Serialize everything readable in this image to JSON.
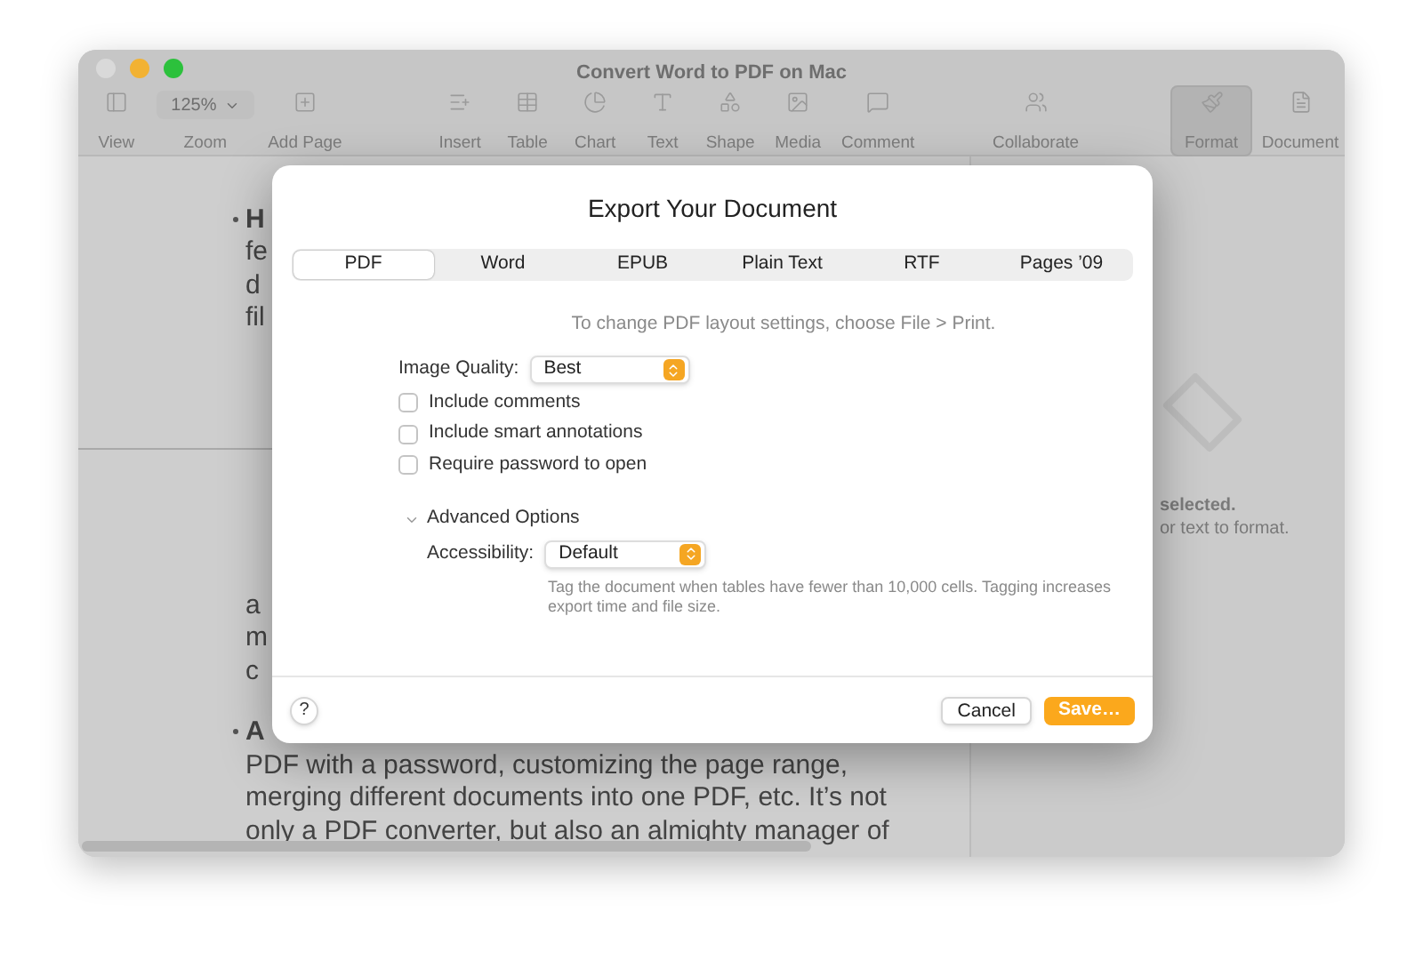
{
  "window": {
    "title": "Convert Word to PDF on Mac"
  },
  "toolbar": [
    {
      "label": "View",
      "selected": false
    },
    {
      "label": "Zoom",
      "value": "125%",
      "selected": false
    },
    {
      "label": "Add Page",
      "selected": false
    },
    {
      "label": "Insert",
      "selected": false
    },
    {
      "label": "Table",
      "selected": false
    },
    {
      "label": "Chart",
      "selected": false
    },
    {
      "label": "Text",
      "selected": false
    },
    {
      "label": "Shape",
      "selected": false
    },
    {
      "label": "Media",
      "selected": false
    },
    {
      "label": "Comment",
      "selected": false
    },
    {
      "label": "Collaborate",
      "selected": false
    },
    {
      "label": "Format",
      "selected": true
    },
    {
      "label": "Document",
      "selected": false
    }
  ],
  "document": {
    "block_1": [
      {
        "text": "H",
        "bullet": true
      },
      {
        "text": "fe",
        "bullet": false
      },
      {
        "text": "d",
        "bullet": false
      },
      {
        "text": "fil",
        "bullet": false
      }
    ],
    "block_2": [
      {
        "text": "a",
        "bullet": false
      },
      {
        "text": "m",
        "bullet": false
      },
      {
        "text": "c",
        "bullet": false
      }
    ],
    "block_3": [
      {
        "text": "A",
        "bullet": true
      },
      {
        "text": "PDF with a password, customizing the page range,",
        "bullet": false
      },
      {
        "text": "merging different documents into one PDF, etc. It’s not",
        "bullet": false
      },
      {
        "text": "only a PDF converter, but also an almighty manager of",
        "bullet": false
      }
    ]
  },
  "inspector": {
    "lines": [
      "selected.",
      "or text to format."
    ]
  },
  "dialog": {
    "title": "Export Your Document",
    "tabs": [
      {
        "label": "PDF",
        "selected": true
      },
      {
        "label": "Word",
        "selected": false
      },
      {
        "label": "EPUB",
        "selected": false
      },
      {
        "label": "Plain Text",
        "selected": false
      },
      {
        "label": "RTF",
        "selected": false
      },
      {
        "label": "Pages ’09",
        "selected": false
      }
    ],
    "info": "To change PDF layout settings, choose File > Print.",
    "image_quality": {
      "label": "Image Quality:",
      "value": "Best"
    },
    "options": [
      {
        "label": "Include comments",
        "checked": false
      },
      {
        "label": "Include smart annotations",
        "checked": false
      },
      {
        "label": "Require password to open",
        "checked": false
      }
    ],
    "advanced": {
      "label": "Advanced Options",
      "expanded": true,
      "accessibility": {
        "label": "Accessibility:",
        "value": "Default"
      },
      "help": "Tag the document when tables have fewer than 10,000 cells. Tagging increases export time and file size."
    },
    "help_button": "?",
    "buttons": [
      {
        "label": "Cancel",
        "kind": "secondary"
      },
      {
        "label": "Save…",
        "kind": "primary"
      }
    ]
  }
}
